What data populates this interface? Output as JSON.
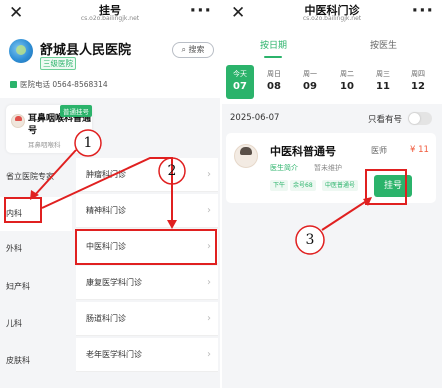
{
  "left": {
    "topbar": {
      "close_icon": "close-icon",
      "title": "挂号",
      "subtitle": "cs.o2o.bailingjk.net",
      "more_icon": "more-dots-icon"
    },
    "hospital": {
      "name": "舒城县人民医院",
      "level": "三级医院",
      "search_label": "搜索",
      "phone_label": "医院电话",
      "phone": "0564-8568314"
    },
    "doctor_card": {
      "name": "耳鼻咽喉科普通号",
      "dept": "耳鼻咽喉科",
      "tag": "普通挂号"
    },
    "departments": [
      "省立医院专家",
      "内科",
      "外科",
      "妇产科",
      "儿科",
      "皮肤科"
    ],
    "selected_department": "内科",
    "sub_departments": [
      "肿瘤科门诊",
      "精神科门诊",
      "中医科门诊",
      "康复医学科门诊",
      "肠道科门诊",
      "老年医学科门诊"
    ],
    "selected_sub_department": "中医科门诊"
  },
  "right": {
    "topbar": {
      "close_icon": "close-icon",
      "title": "中医科门诊",
      "subtitle": "cs.o2o.bailingjk.net",
      "more_icon": "more-dots-icon"
    },
    "tabs": {
      "by_date": "按日期",
      "by_doctor": "按医生"
    },
    "days": [
      {
        "week": "今天",
        "date": "07"
      },
      {
        "week": "周日",
        "date": "08"
      },
      {
        "week": "周一",
        "date": "09"
      },
      {
        "week": "周二",
        "date": "10"
      },
      {
        "week": "周三",
        "date": "11"
      },
      {
        "week": "周四",
        "date": "12"
      }
    ],
    "date": "2025-06-07",
    "only_available_label": "只看有号",
    "clinic": {
      "name": "中医科普通号",
      "title": "医师",
      "price": "¥ 11",
      "intro_label": "医生简介",
      "intro_value": "暂未维护",
      "chips": [
        "下午",
        "余号68",
        "中医普通号"
      ],
      "button": "挂号"
    }
  },
  "annotations": {
    "step1": "1",
    "step2": "2",
    "step3": "3",
    "color": "#e02020"
  },
  "colors": {
    "accent": "#2bb36b",
    "price": "#f05a3c",
    "annotation": "#e02020"
  }
}
